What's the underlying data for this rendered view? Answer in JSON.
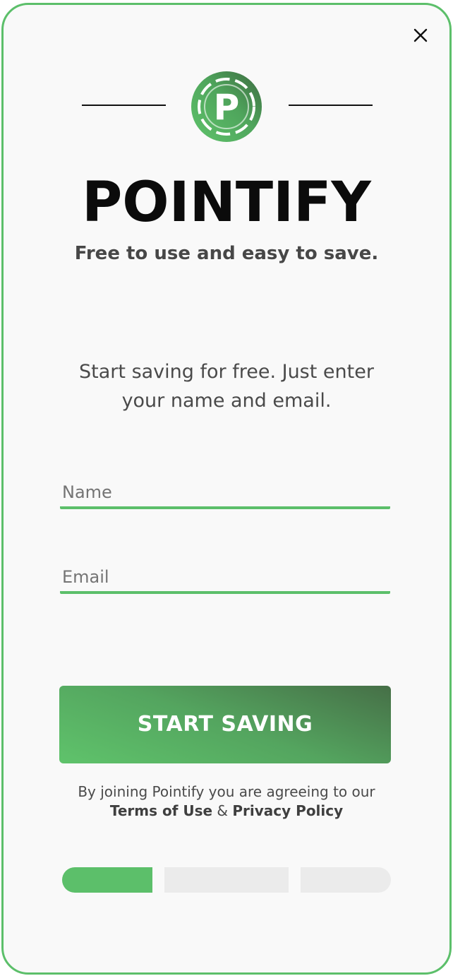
{
  "brand": {
    "name": "POINTIFY",
    "tagline": "Free to use and easy to save.",
    "logo_letter": "P"
  },
  "intro_text": "Start saving for free. Just enter your name and email.",
  "form": {
    "name_placeholder": "Name",
    "email_placeholder": "Email",
    "submit_label": "START SAVING"
  },
  "legal": {
    "prefix": "By joining Pointify you are agreeing to our",
    "terms_label": "Terms of Use",
    "separator": "&",
    "privacy_label": "Privacy Policy"
  },
  "progress": {
    "current_step": 1,
    "total_steps": 3
  },
  "colors": {
    "accent": "#5cbf6a",
    "accent_dark": "#466f47",
    "inactive": "#ebebeb",
    "background": "#f9f9f9"
  },
  "icons": {
    "close": "close-icon",
    "logo": "pointify-logo-icon"
  }
}
